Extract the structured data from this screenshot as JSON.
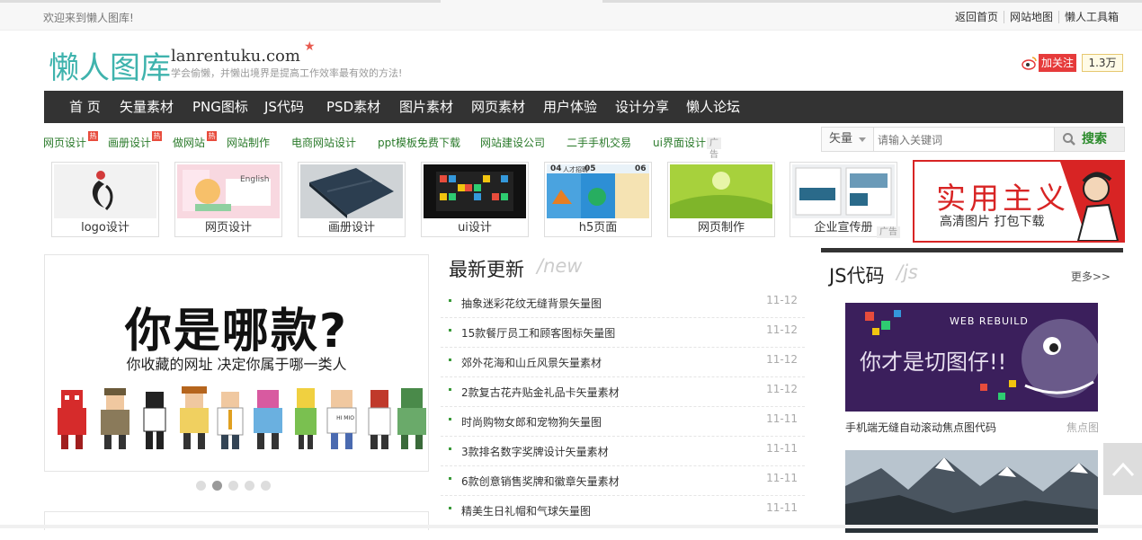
{
  "topbar": {
    "welcome": "欢迎来到懒人图库!",
    "links": [
      "返回首页",
      "网站地图",
      "懒人工具箱"
    ]
  },
  "logo": {
    "cn": "懒人图库",
    "en": "lanrentuku.com",
    "slogan": "学会偷懒，并懒出境界是提高工作效率最有效的方法!"
  },
  "weibo": {
    "follow": "加关注",
    "count": "1.3万"
  },
  "nav": [
    "首 页",
    "矢量素材",
    "PNG图标",
    "JS代码",
    "PSD素材",
    "图片素材",
    "网页素材",
    "用户体验",
    "设计分享",
    "懒人论坛"
  ],
  "hotlinks": [
    {
      "label": "网页设计",
      "hot": true
    },
    {
      "label": "画册设计",
      "hot": true
    },
    {
      "label": "做网站",
      "hot": true
    },
    {
      "label": "网站制作",
      "hot": false
    },
    {
      "label": "电商网站设计",
      "hot": false
    },
    {
      "label": "ppt模板免费下载",
      "hot": false
    },
    {
      "label": "网站建设公司",
      "hot": false
    },
    {
      "label": "二手手机交易",
      "hot": false
    },
    {
      "label": "ui界面设计",
      "hot": false
    }
  ],
  "hot_badge": "热",
  "ad_label": "广告",
  "search": {
    "type": "矢量",
    "placeholder": "请输入关键词",
    "button": "搜索"
  },
  "categories": [
    "logo设计",
    "网页设计",
    "画册设计",
    "ui设计",
    "h5页面",
    "网页制作",
    "企业宣传册"
  ],
  "thumb_text": {
    "web_design": "English",
    "h5_tags": [
      "04",
      "05",
      "06"
    ],
    "h5_label": "人才招聘"
  },
  "banner_ad": {
    "title": "实用主义",
    "subtitle": "高清图片 打包下载"
  },
  "slider": {
    "headline": "你是哪款?",
    "subline": "你收藏的网址 决定你属于哪一类人",
    "active_dot": 1,
    "dot_count": 5,
    "figure_text": "HI MIO"
  },
  "news": {
    "title": "最新更新",
    "subtitle": "/new",
    "items": [
      {
        "title": "抽象迷彩花纹无缝背景矢量图",
        "date": "11-12"
      },
      {
        "title": "15款餐厅员工和顾客图标矢量图",
        "date": "11-12"
      },
      {
        "title": "郊外花海和山丘风景矢量素材",
        "date": "11-12"
      },
      {
        "title": "2款复古花卉贴金礼品卡矢量素材",
        "date": "11-12"
      },
      {
        "title": "时尚购物女郎和宠物狗矢量图",
        "date": "11-11"
      },
      {
        "title": "3款排名数字奖牌设计矢量素材",
        "date": "11-11"
      },
      {
        "title": "6款创意销售奖牌和徽章矢量素材",
        "date": "11-11"
      },
      {
        "title": "精美生日礼帽和气球矢量图",
        "date": "11-11"
      }
    ]
  },
  "js_panel": {
    "title": "JS代码",
    "subtitle": "/js",
    "more": "更多>>",
    "card1": {
      "title": "手机端无缝自动滚动焦点图代码",
      "tag": "焦点图",
      "img_brand": "WEB REBUILD",
      "img_title": "你才是切图仔!!"
    }
  },
  "colors": {
    "nav_bg": "#333333",
    "accent_green": "#2a7a2a",
    "logo_teal": "#3fb3ad",
    "ad_red": "#d82424"
  }
}
